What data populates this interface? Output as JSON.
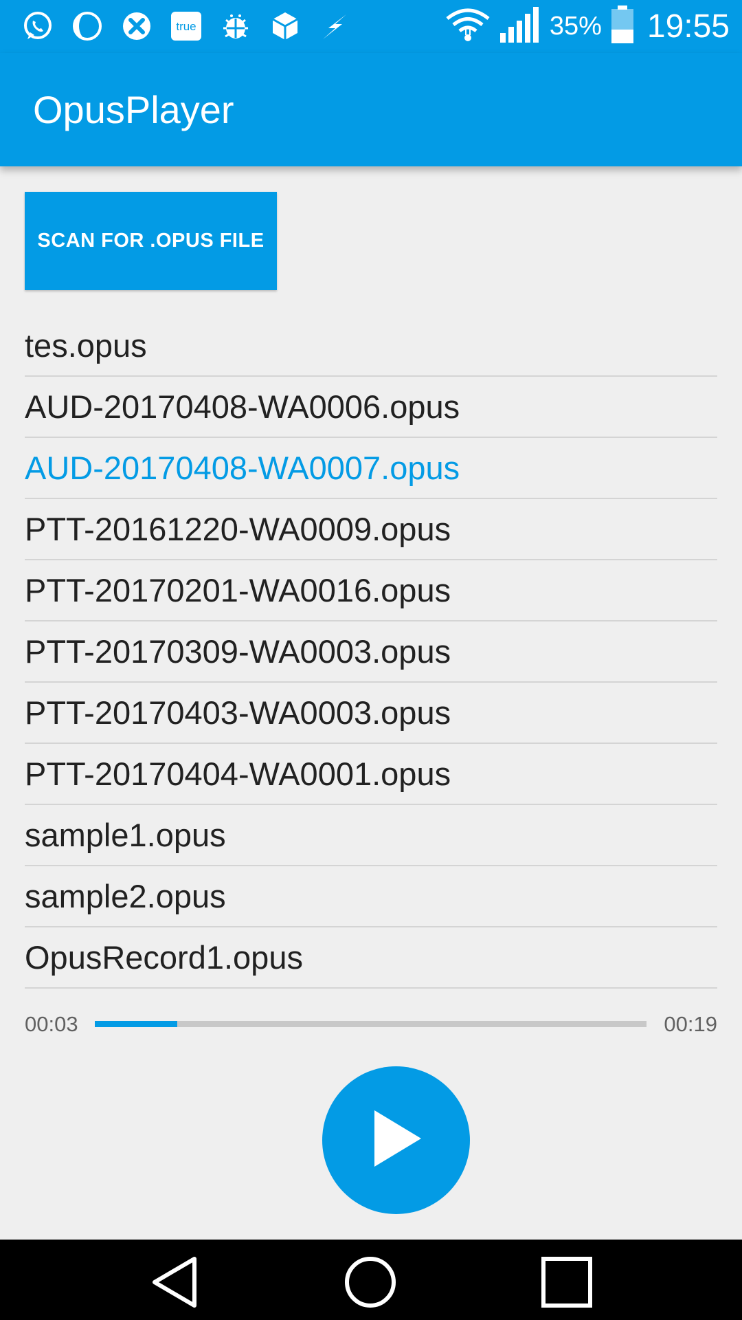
{
  "status_bar": {
    "left_icons": [
      "whatsapp-icon",
      "moon-icon",
      "phone-dialer-icon",
      "true-app-icon",
      "android-debug-icon",
      "dropbox-icon",
      "flash-icon"
    ],
    "true_label": "true",
    "battery_percent": "35%",
    "time": "19:55"
  },
  "app_bar": {
    "title": "OpusPlayer"
  },
  "scan_button": {
    "label": "SCAN FOR .OPUS FILE"
  },
  "files": [
    {
      "name": "tes.opus",
      "selected": false
    },
    {
      "name": "AUD-20170408-WA0006.opus",
      "selected": false
    },
    {
      "name": "AUD-20170408-WA0007.opus",
      "selected": true
    },
    {
      "name": "PTT-20161220-WA0009.opus",
      "selected": false
    },
    {
      "name": "PTT-20170201-WA0016.opus",
      "selected": false
    },
    {
      "name": "PTT-20170309-WA0003.opus",
      "selected": false
    },
    {
      "name": "PTT-20170403-WA0003.opus",
      "selected": false
    },
    {
      "name": "PTT-20170404-WA0001.opus",
      "selected": false
    },
    {
      "name": "sample1.opus",
      "selected": false
    },
    {
      "name": "sample2.opus",
      "selected": false
    },
    {
      "name": "OpusRecord1.opus",
      "selected": false
    }
  ],
  "player": {
    "elapsed": "00:03",
    "total": "00:19",
    "progress_fraction": 0.15
  },
  "colors": {
    "accent": "#039be5",
    "selected_text": "#039be5",
    "text": "#212121"
  },
  "nav_bar": {
    "buttons": [
      "back-icon",
      "home-icon",
      "recents-icon"
    ]
  }
}
